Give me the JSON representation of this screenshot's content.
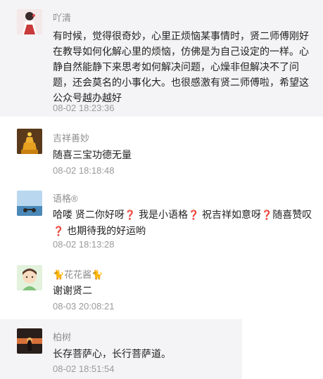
{
  "comments": [
    {
      "name": "吖清",
      "text": "有时候，觉得很奇妙，心里正烦恼某事情时，贤二师傅刚好在教导如何化解心里的烦恼，仿佛是为自己设定的一样。心静自然能静下来思考如何解决问题，心燥非但解决不了问题，还会莫名的小事化大。也很感激有贤二师傅啦，希望这公众号越办越好",
      "time": "08-02 18:23:36"
    },
    {
      "name": "吉祥善妙",
      "text": "随喜三宝功德无量",
      "time": "08-02 18:18:48"
    },
    {
      "name": "语格®",
      "text_parts": [
        "哈喽 贤二你好呀",
        "❓",
        " 我是小语格",
        "❓",
        " 祝吉祥如意呀",
        "❓",
        "随喜赞叹",
        "❓",
        " 也期待我的好运哟"
      ],
      "time": "08-02 18:13:28"
    },
    {
      "name": "🐈花花酱🐈",
      "text": "谢谢贤二",
      "time": "08-03 20:08:21"
    },
    {
      "name": "柏树",
      "text": "长存菩萨心，长行菩萨道。",
      "time": "08-02 18:51:54"
    }
  ]
}
